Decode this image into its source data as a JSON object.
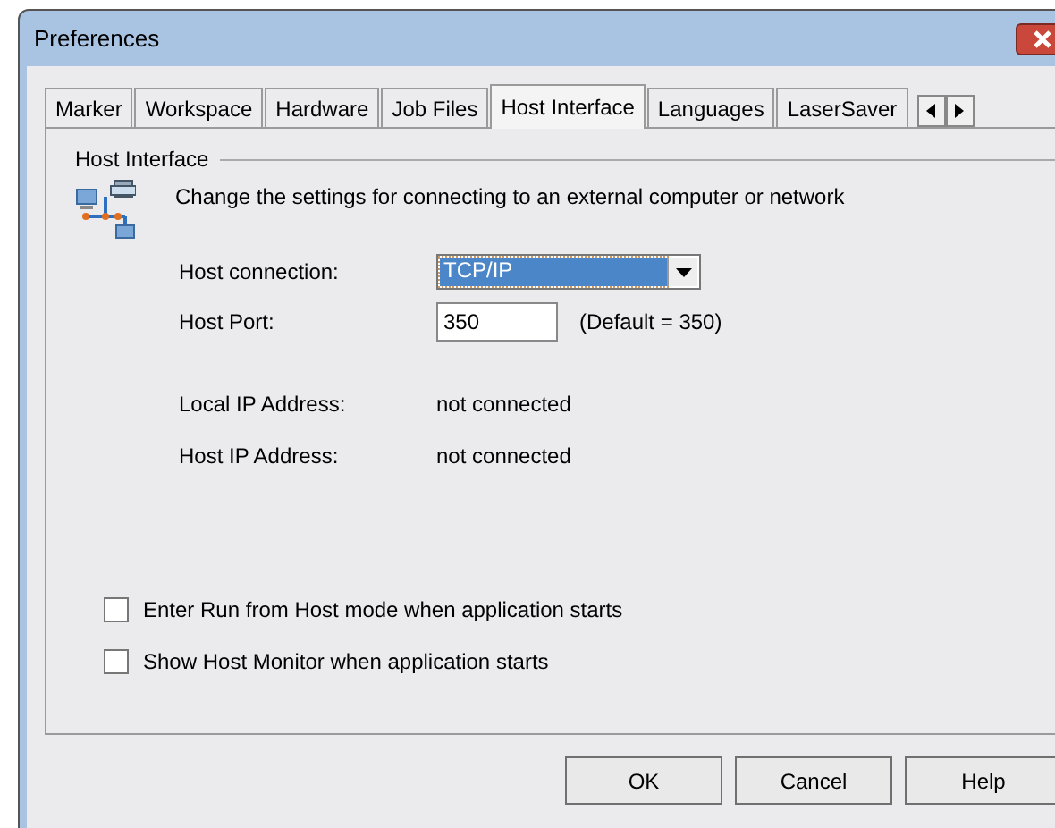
{
  "window": {
    "title": "Preferences"
  },
  "tabs": [
    {
      "label": "Marker",
      "selected": false
    },
    {
      "label": "Workspace",
      "selected": false
    },
    {
      "label": "Hardware",
      "selected": false
    },
    {
      "label": "Job Files",
      "selected": false
    },
    {
      "label": "Host Interface",
      "selected": true
    },
    {
      "label": "Languages",
      "selected": false
    },
    {
      "label": "LaserSaver",
      "selected": false
    }
  ],
  "group": {
    "title": "Host Interface",
    "description": "Change the settings for connecting to an external computer or network"
  },
  "host_connection": {
    "label": "Host connection:",
    "value": "TCP/IP"
  },
  "host_port": {
    "label": "Host Port:",
    "value": "350",
    "note": "(Default = 350)"
  },
  "info": [
    {
      "label": "Local IP Address:",
      "value": "not connected"
    },
    {
      "label": "Host IP Address:",
      "value": "not connected"
    }
  ],
  "checkboxes": [
    {
      "label": "Enter Run from Host mode when application starts",
      "checked": false
    },
    {
      "label": "Show Host Monitor when application starts",
      "checked": false
    }
  ],
  "buttons": [
    "OK",
    "Cancel",
    "Help"
  ]
}
